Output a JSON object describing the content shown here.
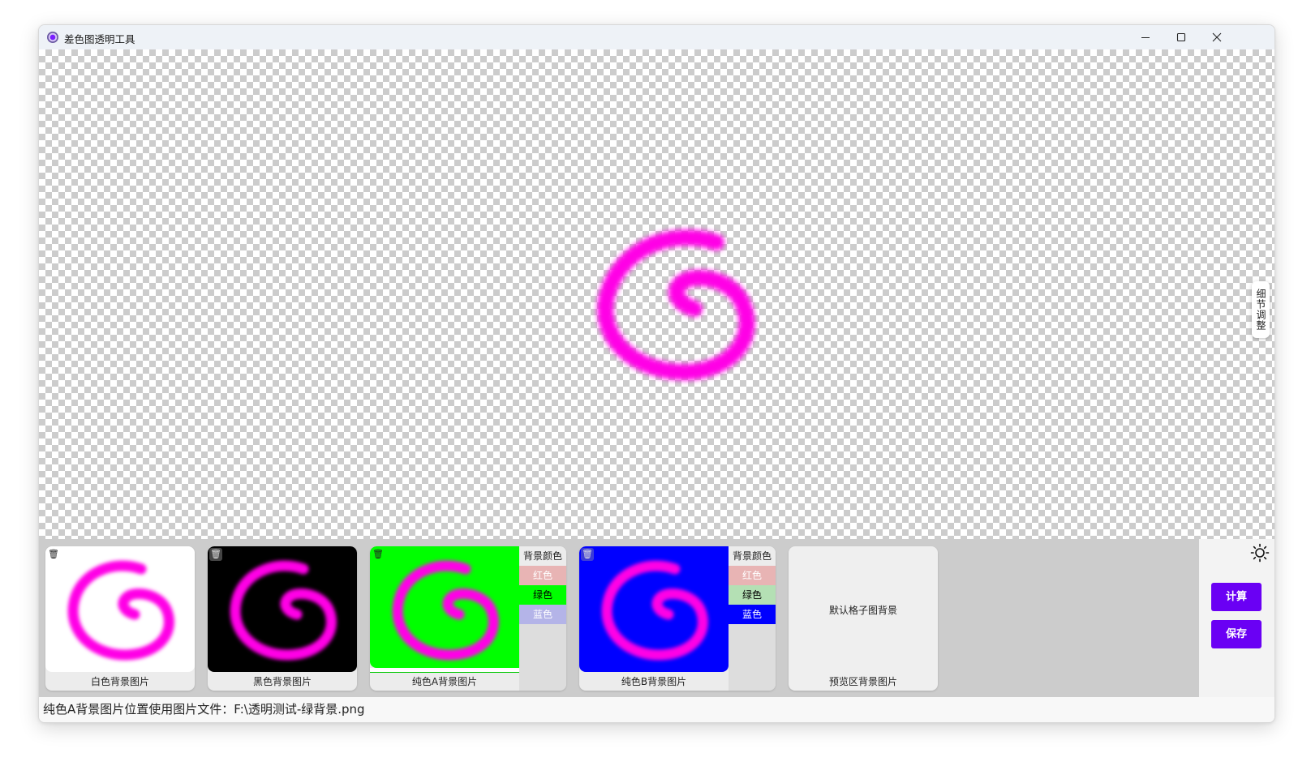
{
  "window": {
    "title": "差色图透明工具"
  },
  "preview": {
    "detail_tab_label": "细节调整"
  },
  "cards": [
    {
      "label": "白色背景图片",
      "background": "#ffffff"
    },
    {
      "label": "黑色背景图片",
      "background": "#000000"
    },
    {
      "label": "纯色A背景图片",
      "background": "#00ff00",
      "panel_title": "背景颜色",
      "options": [
        "红色",
        "绿色",
        "蓝色"
      ],
      "selected": "绿色"
    },
    {
      "label": "纯色B背景图片",
      "background": "#0000ff",
      "panel_title": "背景颜色",
      "options": [
        "红色",
        "绿色",
        "蓝色"
      ],
      "selected": "蓝色"
    },
    {
      "label": "预览区背景图片",
      "placeholder": "默认格子图背景"
    }
  ],
  "actions": {
    "compute_label": "计算",
    "save_label": "保存"
  },
  "status": {
    "text": "纯色A背景图片位置使用图片文件：F:\\透明测试-绿背景.png"
  },
  "colors": {
    "accent": "#6a00f4",
    "spiral": "#ff00e6",
    "option_red": "#e8b4b4",
    "option_green": "#b4e0b4",
    "option_blue": "#b4b4e8"
  }
}
